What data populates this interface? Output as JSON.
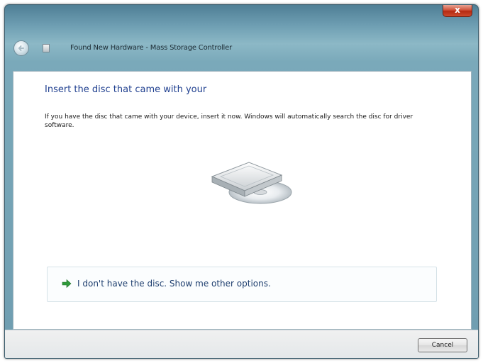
{
  "window": {
    "title": "Found New Hardware - Mass Storage Controller",
    "close_label": "x"
  },
  "content": {
    "heading": "Insert the disc that came with your",
    "body": "If you have the disc that came with your device, insert it now.  Windows will automatically search the disc for driver software.",
    "option_text": "I don't have the disc. Show me other options."
  },
  "footer": {
    "cancel_label": "Cancel"
  },
  "icons": {
    "back": "back-arrow-icon",
    "hardware": "hardware-icon",
    "disc": "disc-drive-icon",
    "option_arrow": "green-arrow-icon"
  },
  "colors": {
    "heading": "#1f3f8f",
    "option_arrow": "#2f9a3a",
    "close_button": "#c8391c"
  }
}
